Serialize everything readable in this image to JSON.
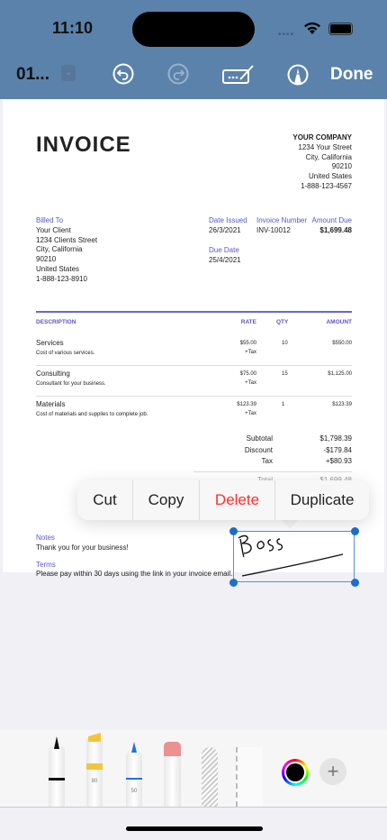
{
  "status": {
    "time": "11:10"
  },
  "toolbar": {
    "doc_name": "01...",
    "done_label": "Done"
  },
  "invoice": {
    "title": "INVOICE",
    "company": [
      "YOUR COMPANY",
      "1234 Your Street",
      "City, California",
      "90210",
      "United States",
      "1-888-123-4567"
    ],
    "billed_to_label": "Billed To",
    "billed_to": [
      "Your Client",
      "1234 Clients Street",
      "City, California",
      "90210",
      "United States",
      "1-888-123-8910"
    ],
    "date_issued_label": "Date Issued",
    "date_issued": "26/3/2021",
    "invoice_number_label": "Invoice Number",
    "invoice_number": "INV-10012",
    "amount_due_label": "Amount Due",
    "amount_due": "$1,699.48",
    "due_date_label": "Due Date",
    "due_date": "25/4/2021",
    "columns": {
      "description": "DESCRIPTION",
      "rate": "RATE",
      "qty": "QTY",
      "amount": "AMOUNT"
    },
    "items": [
      {
        "name": "Services",
        "desc": "Cost of various services.",
        "rate": "$55.00",
        "tax": "+Tax",
        "qty": "10",
        "amount": "$550.00"
      },
      {
        "name": "Consulting",
        "desc": "Consultant for your business.",
        "rate": "$75.00",
        "tax": "+Tax",
        "qty": "15",
        "amount": "$1,125.00"
      },
      {
        "name": "Materials",
        "desc": "Cost of materials and supplies to complete job.",
        "rate": "$123.39",
        "tax": "+Tax",
        "qty": "1",
        "amount": "$123.39"
      }
    ],
    "subtotal_label": "Subtotal",
    "subtotal": "$1,798.39",
    "discount_label": "Discount",
    "discount": "-$179.84",
    "tax_label": "Tax",
    "tax": "+$80.93",
    "total_label": "Total",
    "total": "$1,699.48",
    "notes_label": "Notes",
    "notes": "Thank you for your business!",
    "terms_label": "Terms",
    "terms": "Please pay within 30 days using the link in your invoice email."
  },
  "context_menu": {
    "cut": "Cut",
    "copy": "Copy",
    "delete": "Delete",
    "duplicate": "Duplicate"
  },
  "tools": {
    "highlighter_width": "80",
    "pen_width": "50"
  },
  "colors": {
    "header": "#5b82aa",
    "accent": "#5a55c8",
    "delete": "#ff2d2d",
    "selection": "#1e6fd0"
  }
}
